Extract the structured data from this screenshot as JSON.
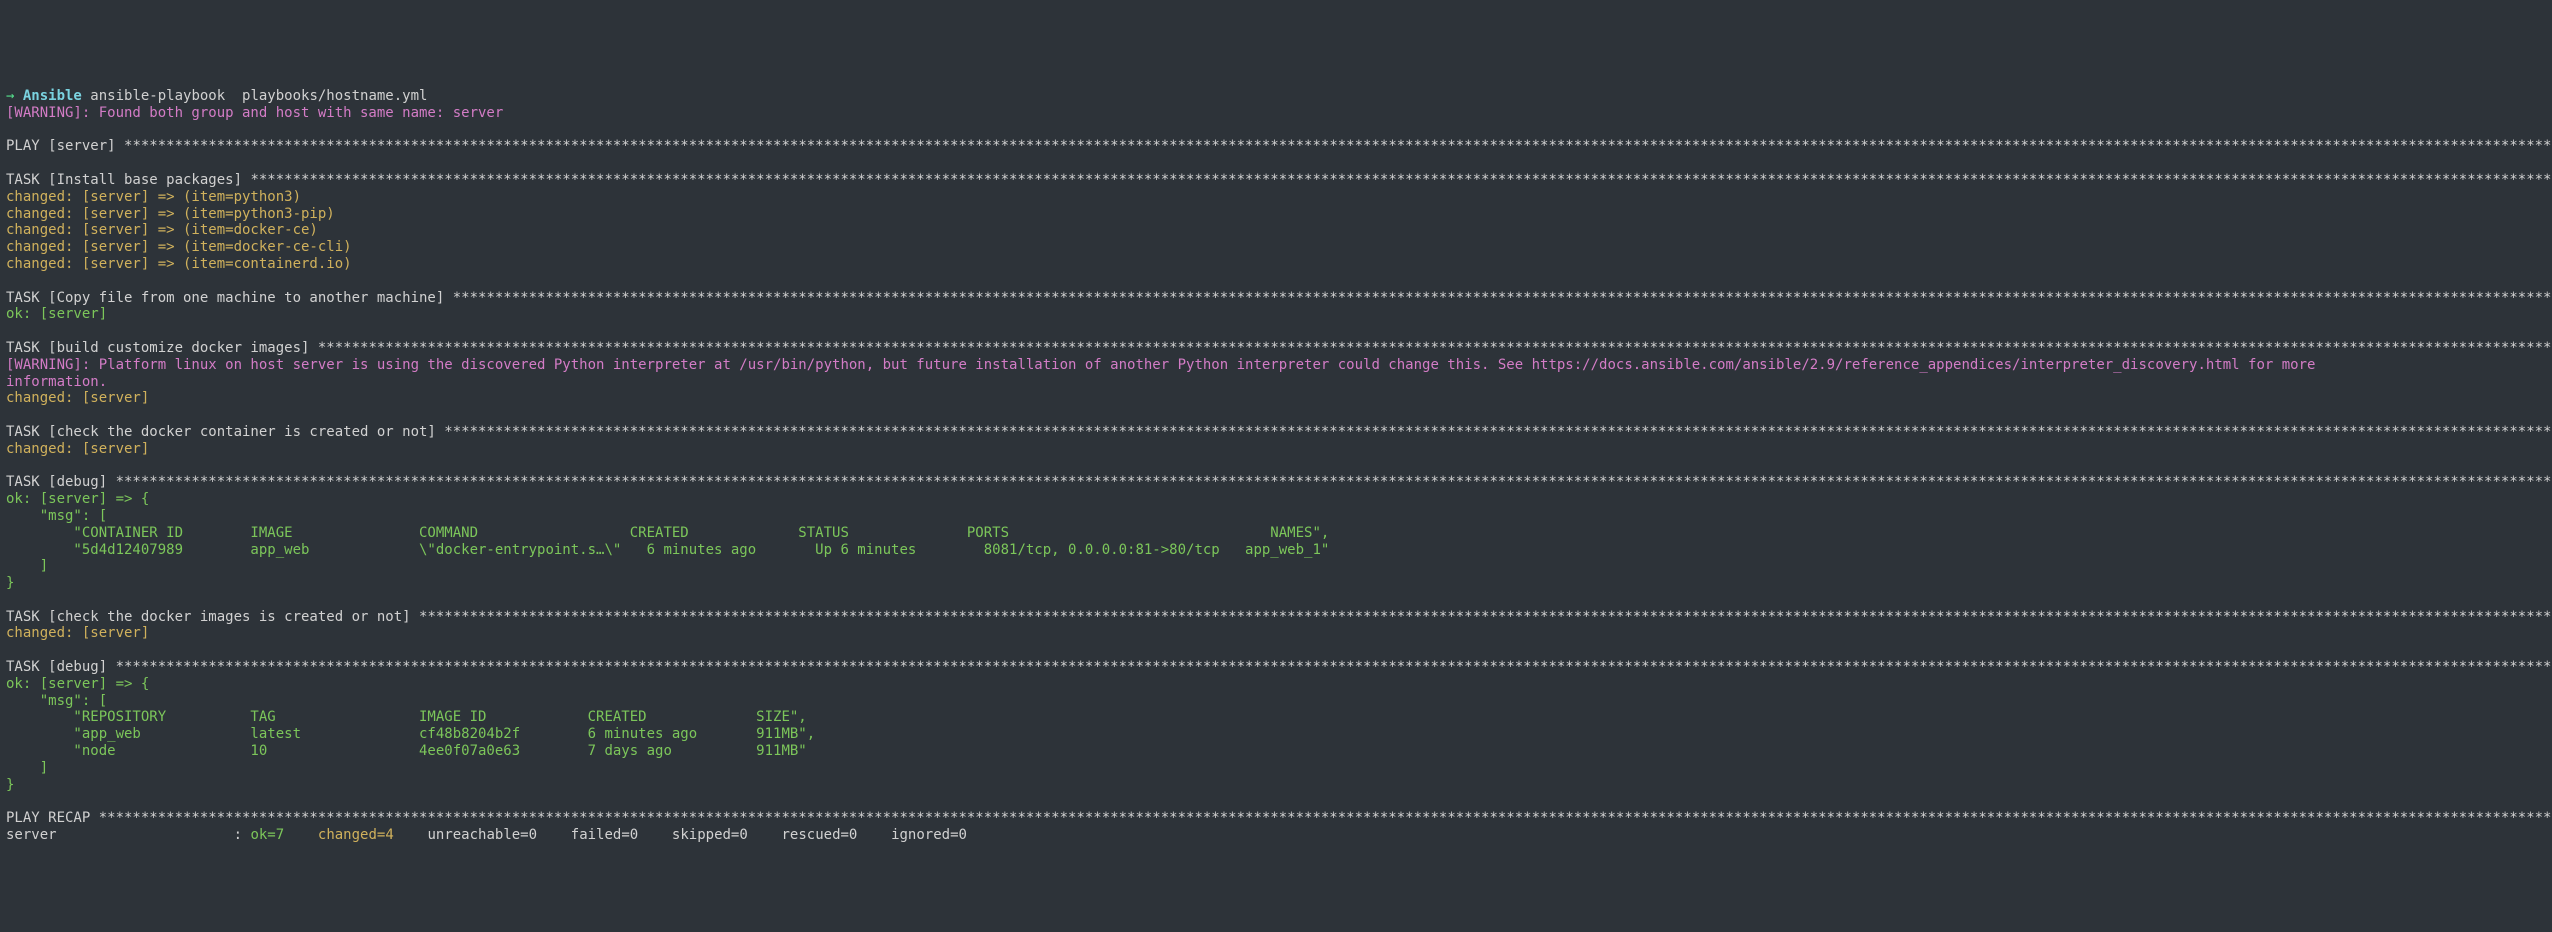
{
  "prompt": {
    "arrow": "→ ",
    "dir": "Ansible",
    "cmd": " ansible-playbook  playbooks/hostname.yml"
  },
  "warn1": "[WARNING]: Found both group and host with same name: server",
  "play_header": "PLAY [server] ",
  "task1_header": "TASK [Install base packages] ",
  "task1_items": [
    "changed: [server] => (item=python3)",
    "changed: [server] => (item=python3-pip)",
    "changed: [server] => (item=docker-ce)",
    "changed: [server] => (item=docker-ce-cli)",
    "changed: [server] => (item=containerd.io)"
  ],
  "task2_header": "TASK [Copy file from one machine to another machine] ",
  "task2_result": "ok: [server]",
  "task3_header": "TASK [build customize docker images] ",
  "warn2a": "[WARNING]: Platform linux on host server is using the discovered Python interpreter at /usr/bin/python, but future installation of another Python interpreter could change this. See https://docs.ansible.com/ansible/2.9/reference_appendices/interpreter_discovery.html for more",
  "warn2b": "information.",
  "task3_result": "changed: [server]",
  "task4_header": "TASK [check the docker container is created or not] ",
  "task4_result": "changed: [server]",
  "task5_header": "TASK [debug] ",
  "task5_open": "ok: [server] => {",
  "task5_msg_key": "    \"msg\": [",
  "task5_line1": "        \"CONTAINER ID        IMAGE               COMMAND                  CREATED             STATUS              PORTS                               NAMES\",",
  "task5_line2": "        \"5d4d12407989        app_web             \\\"docker-entrypoint.s…\\\"   6 minutes ago       Up 6 minutes        8081/tcp, 0.0.0.0:81->80/tcp   app_web_1\"",
  "task5_close1": "    ]",
  "task5_close2": "}",
  "task6_header": "TASK [check the docker images is created or not] ",
  "task6_result": "changed: [server]",
  "task7_header": "TASK [debug] ",
  "task7_open": "ok: [server] => {",
  "task7_msg_key": "    \"msg\": [",
  "task7_line1": "        \"REPOSITORY          TAG                 IMAGE ID            CREATED             SIZE\",",
  "task7_line2": "        \"app_web             latest              cf48b8204b2f        6 minutes ago       911MB\",",
  "task7_line3": "        \"node                10                  4ee0f07a0e63        7 days ago          911MB\"",
  "task7_close1": "    ]",
  "task7_close2": "}",
  "recap_header": "PLAY RECAP ",
  "recap": {
    "host": "server",
    "sep": "                     : ",
    "ok": "ok=7",
    "sp1": "    ",
    "changed": "changed=4",
    "sp2": "    ",
    "unreachable": "unreachable=0",
    "sp3": "    ",
    "failed": "failed=0",
    "sp4": "    ",
    "skipped": "skipped=0",
    "sp5": "    ",
    "rescued": "rescued=0",
    "sp6": "    ",
    "ignored": "ignored=0"
  },
  "chart_data": {
    "type": "table",
    "title": "docker ps output",
    "columns": [
      "CONTAINER ID",
      "IMAGE",
      "COMMAND",
      "CREATED",
      "STATUS",
      "PORTS",
      "NAMES"
    ],
    "rows": [
      [
        "5d4d12407989",
        "app_web",
        "docker-entrypoint.s…",
        "6 minutes ago",
        "Up 6 minutes",
        "8081/tcp, 0.0.0.0:81->80/tcp",
        "app_web_1"
      ]
    ],
    "images_table": {
      "columns": [
        "REPOSITORY",
        "TAG",
        "IMAGE ID",
        "CREATED",
        "SIZE"
      ],
      "rows": [
        [
          "app_web",
          "latest",
          "cf48b8204b2f",
          "6 minutes ago",
          "911MB"
        ],
        [
          "node",
          "10",
          "4ee0f07a0e63",
          "7 days ago",
          "911MB"
        ]
      ]
    },
    "recap_counts": {
      "ok": 7,
      "changed": 4,
      "unreachable": 0,
      "failed": 0,
      "skipped": 0,
      "rescued": 0,
      "ignored": 0
    }
  }
}
